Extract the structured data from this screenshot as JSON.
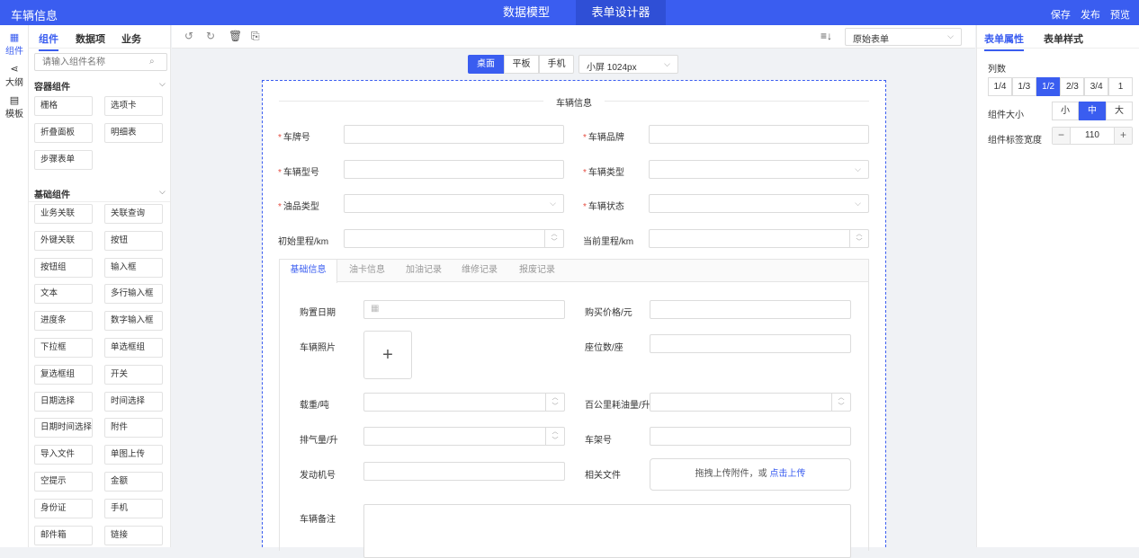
{
  "topbar": {
    "title": "车辆信息",
    "tabs": [
      "数据模型",
      "表单设计器"
    ],
    "actions": [
      "保存",
      "发布",
      "预览"
    ]
  },
  "rail": [
    "组件",
    "大纲",
    "模板"
  ],
  "left": {
    "tabs": [
      "组件",
      "数据项",
      "业务"
    ],
    "search_placeholder": "请输入组件名称",
    "container_title": "容器组件",
    "container_items": [
      "栅格",
      "选项卡",
      "折叠面板",
      "明细表",
      "步骤表单"
    ],
    "basic_title": "基础组件",
    "basic_items": [
      "业务关联",
      "关联查询",
      "外键关联",
      "按钮",
      "按钮组",
      "输入框",
      "文本",
      "多行输入框",
      "进度条",
      "数字输入框",
      "下拉框",
      "单选框组",
      "复选框组",
      "开关",
      "日期选择",
      "时间选择",
      "日期时间选择",
      "附件",
      "导入文件",
      "单图上传",
      "空提示",
      "金额",
      "身份证",
      "手机",
      "邮件箱",
      "链接"
    ]
  },
  "toolbar": {
    "icons": [
      "undo-icon",
      "redo-icon",
      "trash-icon",
      "export-icon"
    ],
    "form_select": "原始表单"
  },
  "device": {
    "options": [
      "桌面",
      "平板",
      "手机"
    ],
    "active": "桌面",
    "resolution": "小屏 1024px"
  },
  "form": {
    "title": "车辆信息",
    "top_fields": [
      {
        "label": "车牌号",
        "required": true,
        "type": "text"
      },
      {
        "label": "车辆品牌",
        "required": true,
        "type": "text"
      },
      {
        "label": "车辆型号",
        "required": true,
        "type": "text"
      },
      {
        "label": "车辆类型",
        "required": true,
        "type": "select"
      },
      {
        "label": "油品类型",
        "required": true,
        "type": "select"
      },
      {
        "label": "车辆状态",
        "required": true,
        "type": "select"
      },
      {
        "label": "初始里程/km",
        "required": false,
        "type": "number"
      },
      {
        "label": "当前里程/km",
        "required": false,
        "type": "number"
      }
    ],
    "tabs": [
      "基础信息",
      "油卡信息",
      "加油记录",
      "维修记录",
      "报废记录"
    ],
    "active_tab": "基础信息",
    "tab_fields": {
      "purchase_date": "购置日期",
      "purchase_price": "购买价格/元",
      "photo": "车辆照片",
      "seats": "座位数/座",
      "load": "载重/吨",
      "fuel": "百公里耗油量/升",
      "displacement": "排气量/升",
      "vin": "车架号",
      "engine": "发动机号",
      "files": "相关文件",
      "remark": "车辆备注"
    },
    "upload_hint": "拖拽上传附件，或",
    "upload_link": "点击上传"
  },
  "right": {
    "tabs": [
      "表单属性",
      "表单样式"
    ],
    "columns_label": "列数",
    "columns": [
      "1/4",
      "1/3",
      "1/2",
      "2/3",
      "3/4",
      "1"
    ],
    "columns_active": "1/2",
    "size_label": "组件大小",
    "sizes": [
      "小",
      "中",
      "大"
    ],
    "size_active": "中",
    "label_width_label": "组件标签宽度",
    "label_width": "110"
  }
}
